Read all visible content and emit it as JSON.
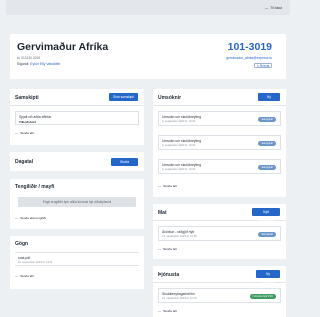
{
  "topbar": {
    "link": "Til baka"
  },
  "header": {
    "title": "Gervimaður Afríka",
    "kennitala": "kt. 010130-3019",
    "owner_label": "Eigandi:",
    "owner_name": "Eyrún Elly Valsdóttir",
    "number": "101-3019",
    "email": "gervimadur_afrika@express.is",
    "edit_label": "Breyta"
  },
  "samskipti": {
    "title": "Samskipti",
    "button": "Skrá samskipti",
    "item_title": "Spjall við aðila eftirfar",
    "item_sub": "Tilboðsbréf",
    "more": "Skoða allt"
  },
  "umsoknir": {
    "title": "Umsóknir",
    "button": "Ný umsókn",
    "items": [
      {
        "title": "Umsókn um skuldbreyting",
        "date": "3. september 2023 kl. 16:04",
        "badge": "Samþykkt"
      },
      {
        "title": "Umsókn um skuldbreyting",
        "date": "3. september 2023 kl. 16:04",
        "badge": "Samþykkt"
      },
      {
        "title": "Umsókn um skuldbreyting",
        "date": "3. september 2023 kl. 16:04",
        "badge": "Samþykkt"
      }
    ],
    "more": "Skoða allt"
  },
  "dagatal": {
    "title": "Dagatal",
    "button": "Skoða viðburð"
  },
  "tengslir": {
    "title": "Tengiliðir / mayfi",
    "empty": "Engir tengiliðir fyrir aðila fundust hjá viðskiptavini",
    "more": "Skoða alla tengiliði"
  },
  "gogn": {
    "title": "Gögn",
    "item_title": "smá.pdf",
    "item_sub": "11. september 2023 kl. 14:11",
    "more": "Skoða allt"
  },
  "mat": {
    "title": "Mat",
    "button": "Nýtt ráðgjafamat",
    "item_title": "Ávöxtun - ráðgjöf nýtt",
    "item_sub": "21. september 2023 kl. 11:15",
    "badge": "Samþykkt",
    "more": "Skoða allt"
  },
  "thjonusta": {
    "title": "Þjónusta",
    "button": "Ný þjónusta",
    "item_title": "Skuldbreytingarbeiðni",
    "item_sub": "21. september 2023 kl. 11:15",
    "badge": "Í vinnslu hjá VVK",
    "more": "Skoða allt"
  },
  "colors": {
    "accent": "#2567c8",
    "badge_blue": "#6c95c9",
    "badge_green": "#3f9b5f"
  },
  "icons": {
    "back": "arrow-left-icon",
    "edit": "pencil-icon",
    "more": "arrow-right-icon"
  }
}
